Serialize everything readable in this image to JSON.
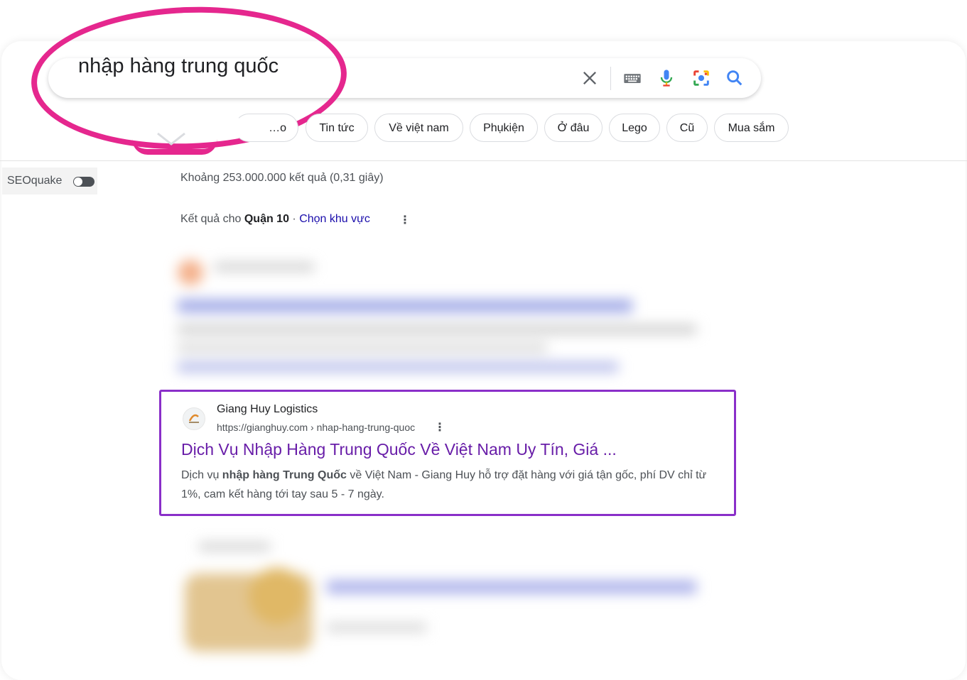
{
  "search": {
    "query": "nhập hàng trung quốc"
  },
  "chips": [
    "…o",
    "Tin tức",
    "Về việt nam",
    "Phụkiện",
    "Ở đâu",
    "Lego",
    "Cũ",
    "Mua sắm"
  ],
  "seoquake": {
    "label": "SEOquake"
  },
  "stats": "Khoảng 253.000.000 kết quả (0,31 giây)",
  "region": {
    "prefix": "Kết quả cho ",
    "place": "Quận 10",
    "separator": " · ",
    "choose": "Chọn khu vực"
  },
  "result": {
    "site_name": "Giang Huy Logistics",
    "url": "https://gianghuy.com › nhap-hang-trung-quoc",
    "title": "Dịch Vụ Nhập Hàng Trung Quốc Về Việt Nam Uy Tín, Giá ...",
    "snippet_before": "Dịch vụ ",
    "snippet_bold": "nhập hàng Trung Quốc",
    "snippet_after": " về Việt Nam - Giang Huy hỗ trợ đặt hàng với giá tận gốc, phí DV chỉ từ 1%, cam kết hàng tới tay sau 5 - 7 ngày."
  },
  "colors": {
    "annotation": "#e5278e",
    "highlight_border": "#8a2fc9",
    "visited_link": "#681da8",
    "link": "#1a0dab"
  },
  "icons": [
    "close-icon",
    "keyboard-icon",
    "microphone-icon",
    "lens-icon",
    "search-icon"
  ]
}
